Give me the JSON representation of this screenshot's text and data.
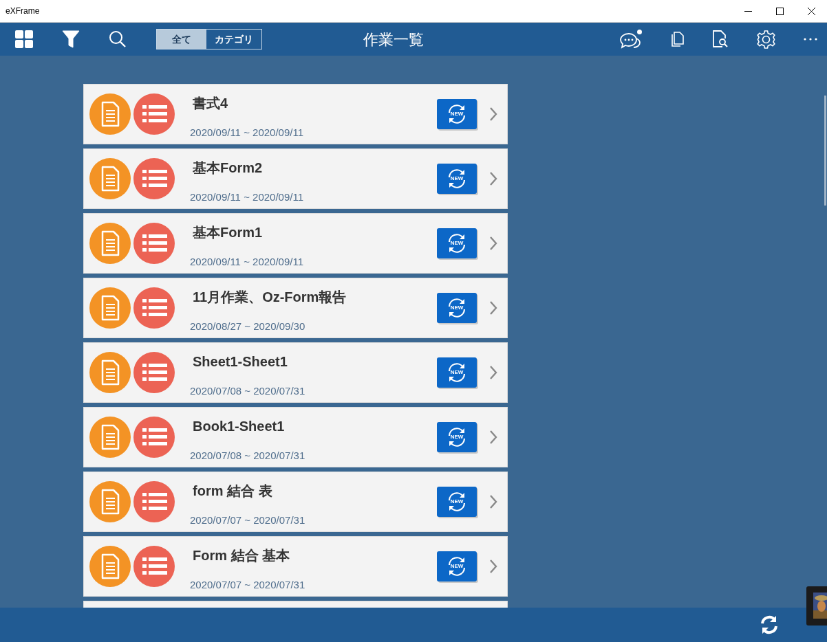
{
  "window": {
    "title": "eXFrame"
  },
  "toolbar": {
    "segments": [
      {
        "label": "全て",
        "selected": true
      },
      {
        "label": "カテゴリ",
        "selected": false
      }
    ],
    "title": "作業一覧",
    "chat_unread": true
  },
  "items": [
    {
      "title": "書式4",
      "period": "2020/09/11 ~ 2020/09/11",
      "badge": "NEW"
    },
    {
      "title": "基本Form2",
      "period": "2020/09/11 ~ 2020/09/11",
      "badge": "NEW"
    },
    {
      "title": "基本Form1",
      "period": "2020/09/11 ~ 2020/09/11",
      "badge": "NEW"
    },
    {
      "title": "11月作業、Oz-Form報告",
      "period": "2020/08/27 ~ 2020/09/30",
      "badge": "NEW"
    },
    {
      "title": "Sheet1-Sheet1",
      "period": "2020/07/08 ~ 2020/07/31",
      "badge": "NEW"
    },
    {
      "title": "Book1-Sheet1",
      "period": "2020/07/08 ~ 2020/07/31",
      "badge": "NEW"
    },
    {
      "title": "form 結合 表",
      "period": "2020/07/07 ~ 2020/07/31",
      "badge": "NEW"
    },
    {
      "title": "Form 結合 基本",
      "period": "2020/07/07 ~ 2020/07/31",
      "badge": "NEW"
    }
  ]
}
